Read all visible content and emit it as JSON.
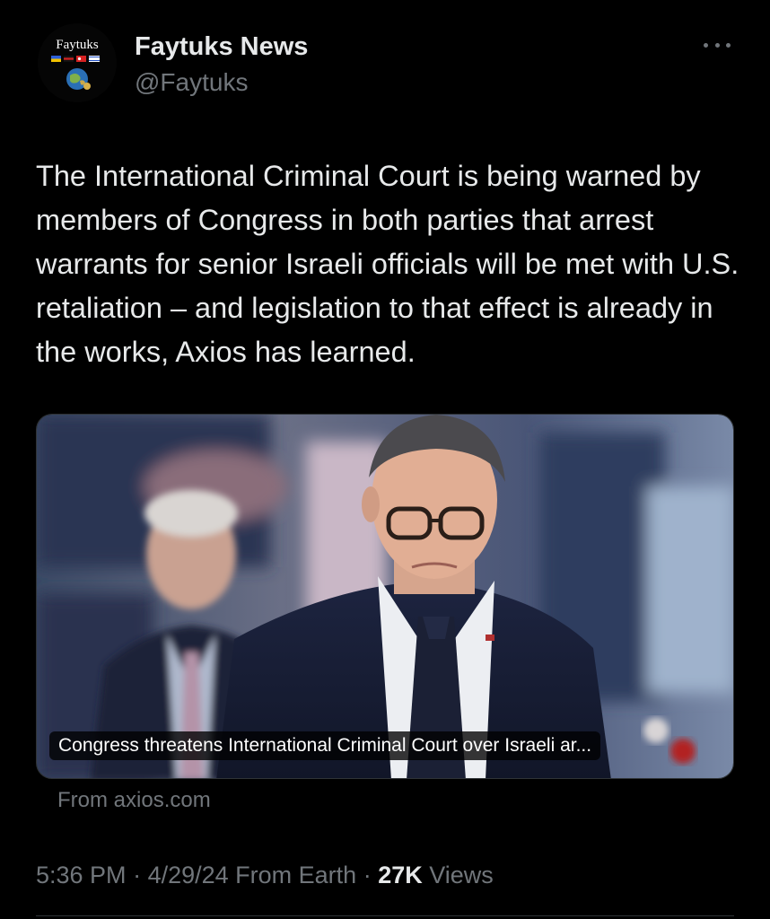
{
  "author": {
    "display_name": "Faytuks News",
    "handle": "@Faytuks",
    "avatar_text": "Faytuks"
  },
  "header": {
    "more_icon": "more-horizontal-icon"
  },
  "tweet": {
    "text": "The International Criminal Court is being warned by members of Congress in both parties that arrest warrants for senior Israeli officials will be met with U.S. retaliation – and legislation to that effect is already in the works, Axios has learned."
  },
  "card": {
    "title": "Congress threatens International Criminal Court over Israeli ar...",
    "source": "From axios.com"
  },
  "meta": {
    "time": "5:36 PM",
    "sep1": " · ",
    "date": "4/29/24",
    "client": " From Earth",
    "sep2": " · ",
    "views_count": "27K",
    "views_label": " Views"
  },
  "colors": {
    "background": "#000000",
    "primary_text": "#e7e9ea",
    "secondary_text": "#71767b",
    "border": "#2f3336"
  }
}
